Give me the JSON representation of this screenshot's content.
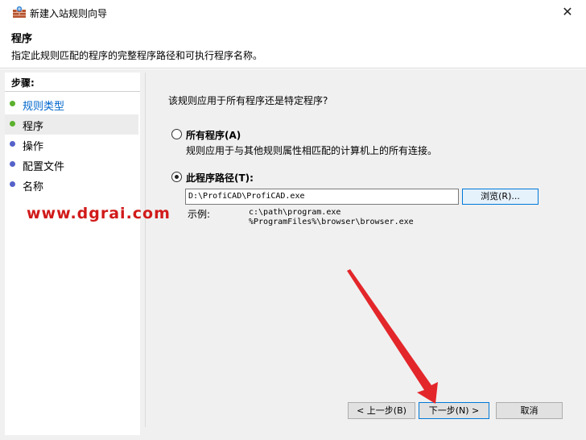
{
  "window": {
    "title": "新建入站规则向导",
    "close_glyph": "✕"
  },
  "header": {
    "heading": "程序",
    "description": "指定此规则匹配的程序的完整程序路径和可执行程序名称。"
  },
  "steps": {
    "title": "步骤:",
    "items": [
      {
        "label": "规则类型",
        "state": "done"
      },
      {
        "label": "程序",
        "state": "current"
      },
      {
        "label": "操作",
        "state": "todo"
      },
      {
        "label": "配置文件",
        "state": "todo"
      },
      {
        "label": "名称",
        "state": "todo"
      }
    ]
  },
  "main": {
    "question": "该规则应用于所有程序还是特定程序?",
    "option_all": {
      "label": "所有程序(A)",
      "description": "规则应用于与其他规则属性相匹配的计算机上的所有连接。",
      "selected": false
    },
    "option_path": {
      "label": "此程序路径(T):",
      "selected": true,
      "value": "D:\\ProfiCAD\\ProfiCAD.exe",
      "browse_label": "浏览(R)...",
      "example_label": "示例:",
      "example_1": "c:\\path\\program.exe",
      "example_2": "%ProgramFiles%\\browser\\browser.exe"
    }
  },
  "watermark": "www.dgrai.com",
  "footer": {
    "back_label": "< 上一步(B)",
    "next_label": "下一步(N) >",
    "cancel_label": "取消"
  },
  "colors": {
    "done_dot": "#5bb12e",
    "todo_dot": "#5562c9",
    "annotation_arrow": "#e3262a",
    "watermark": "#d11a1a"
  }
}
